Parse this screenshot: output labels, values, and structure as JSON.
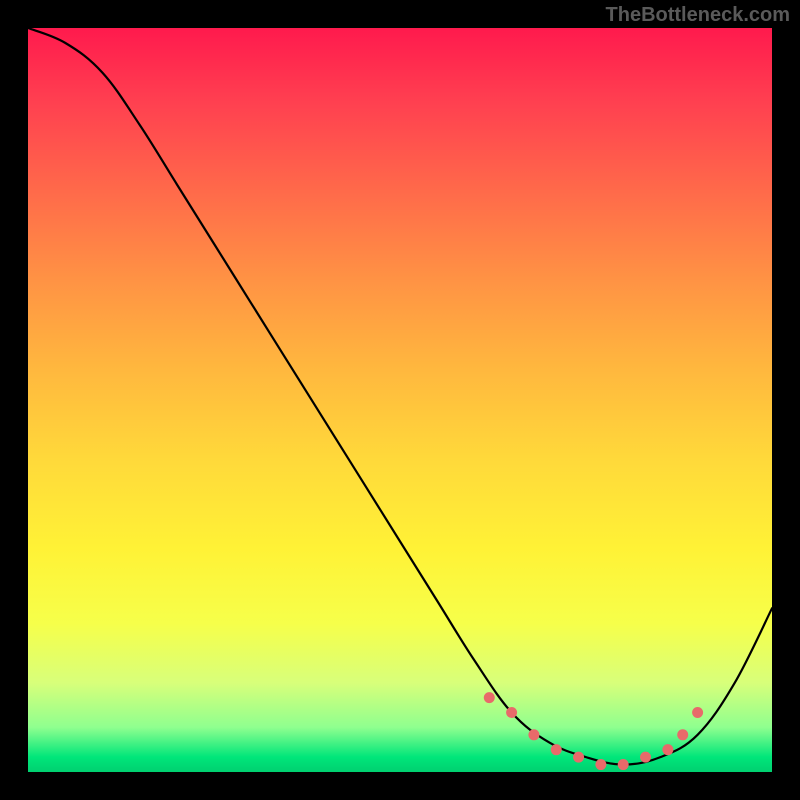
{
  "watermark": "TheBottleneck.com",
  "chart_data": {
    "type": "line",
    "title": "",
    "xlabel": "",
    "ylabel": "",
    "xlim": [
      0,
      100
    ],
    "ylim": [
      0,
      100
    ],
    "series": [
      {
        "name": "curve",
        "x": [
          0,
          5,
          10,
          15,
          20,
          25,
          30,
          35,
          40,
          45,
          50,
          55,
          60,
          65,
          70,
          75,
          80,
          85,
          90,
          95,
          100
        ],
        "values": [
          100,
          98,
          94,
          87,
          79,
          71,
          63,
          55,
          47,
          39,
          31,
          23,
          15,
          8,
          4,
          2,
          1,
          2,
          5,
          12,
          22
        ]
      }
    ],
    "markers": {
      "x": [
        62,
        65,
        68,
        71,
        74,
        77,
        80,
        83,
        86,
        88,
        90
      ],
      "values": [
        10,
        8,
        5,
        3,
        2,
        1,
        1,
        2,
        3,
        5,
        8
      ]
    },
    "gradient_stops": [
      {
        "pos": 0.0,
        "color": "#ff1a4d"
      },
      {
        "pos": 0.1,
        "color": "#ff4050"
      },
      {
        "pos": 0.22,
        "color": "#ff6a4a"
      },
      {
        "pos": 0.34,
        "color": "#ff9344"
      },
      {
        "pos": 0.46,
        "color": "#ffb83e"
      },
      {
        "pos": 0.58,
        "color": "#ffd93a"
      },
      {
        "pos": 0.7,
        "color": "#fff236"
      },
      {
        "pos": 0.8,
        "color": "#f6ff4a"
      },
      {
        "pos": 0.88,
        "color": "#d8ff7a"
      },
      {
        "pos": 0.94,
        "color": "#8fff8f"
      },
      {
        "pos": 0.98,
        "color": "#00e67a"
      },
      {
        "pos": 1.0,
        "color": "#00d070"
      }
    ]
  }
}
